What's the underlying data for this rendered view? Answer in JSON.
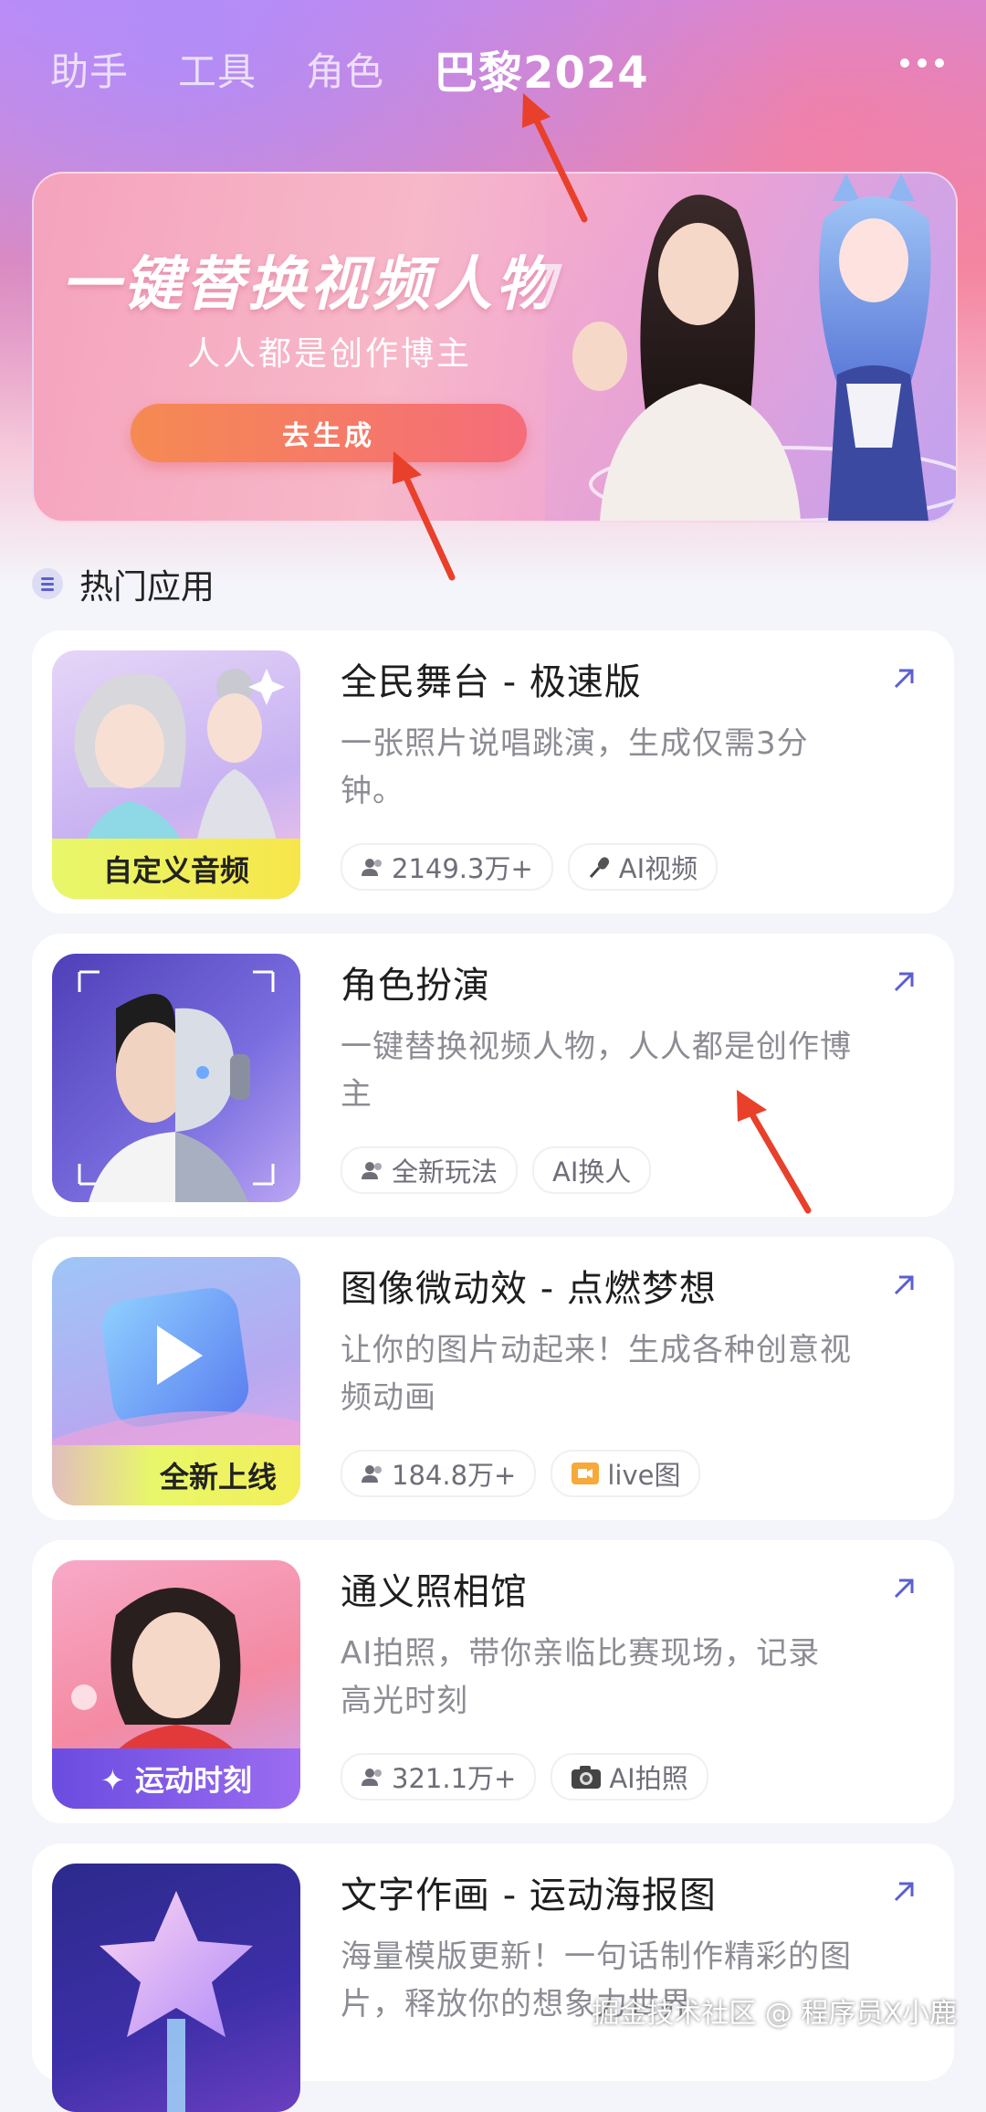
{
  "tabs": [
    "助手",
    "工具",
    "角色",
    "巴黎2024"
  ],
  "active_tab": "巴黎2024",
  "banner": {
    "title": "一键替换视频人物",
    "subtitle": "人人都是创作博主",
    "cta": "去生成"
  },
  "section": {
    "title": "热门应用"
  },
  "apps": [
    {
      "title": "全民舞台 - 极速版",
      "desc": "一张照片说唱跳演，生成仅需3分钟。",
      "thumb_tag": "自定义音频",
      "pills": [
        {
          "icon": "users-icon",
          "text": "2149.3万+"
        },
        {
          "icon": "microphone-icon",
          "text": "AI视频"
        }
      ]
    },
    {
      "title": "角色扮演",
      "desc": "一键替换视频人物，人人都是创作博主",
      "thumb_tag": "",
      "pills": [
        {
          "icon": "users-icon",
          "text": "全新玩法"
        },
        {
          "icon": "",
          "text": "AI换人"
        }
      ]
    },
    {
      "title": "图像微动效 - 点燃梦想",
      "desc": "让你的图片动起来！生成各种创意视频动画",
      "thumb_tag": "全新上线",
      "pills": [
        {
          "icon": "users-icon",
          "text": "184.8万+"
        },
        {
          "icon": "video-camera-icon",
          "text": "live图"
        }
      ]
    },
    {
      "title": "通义照相馆",
      "desc": "AI拍照，带你亲临比赛现场，记录高光时刻",
      "thumb_tag": "✦ 运动时刻",
      "pills": [
        {
          "icon": "users-icon",
          "text": "321.1万+"
        },
        {
          "icon": "camera-icon",
          "text": "AI拍照"
        }
      ]
    },
    {
      "title": "文字作画 - 运动海报图",
      "desc": "海量模版更新！一句话制作精彩的图片，释放你的想象力世界",
      "thumb_tag": "",
      "pills": []
    }
  ],
  "watermark": "掘金技术社区 @ 程序员X小鹿"
}
